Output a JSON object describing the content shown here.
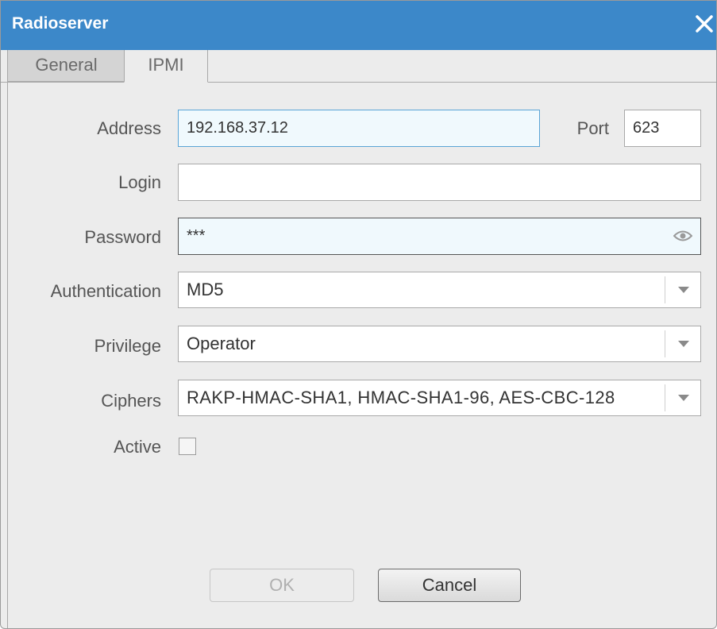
{
  "window": {
    "title": "Radioserver",
    "close_icon": "close-icon",
    "accent_color": "#3c88c9"
  },
  "tabs": [
    {
      "label": "General",
      "selected": false
    },
    {
      "label": "IPMI",
      "selected": true
    }
  ],
  "form": {
    "address": {
      "label": "Address",
      "value": "192.168.37.12"
    },
    "port": {
      "label": "Port",
      "value": "623"
    },
    "login": {
      "label": "Login",
      "value": ""
    },
    "password": {
      "label": "Password",
      "value": "***",
      "reveal_icon": "eye-icon"
    },
    "authentication": {
      "label": "Authentication",
      "value": "MD5"
    },
    "privilege": {
      "label": "Privilege",
      "value": "Operator"
    },
    "ciphers": {
      "label": "Ciphers",
      "value": "RAKP-HMAC-SHA1, HMAC-SHA1-96, AES-CBC-128"
    },
    "active": {
      "label": "Active",
      "checked": false
    }
  },
  "buttons": {
    "ok": {
      "label": "OK",
      "enabled": false
    },
    "cancel": {
      "label": "Cancel",
      "enabled": true
    }
  }
}
